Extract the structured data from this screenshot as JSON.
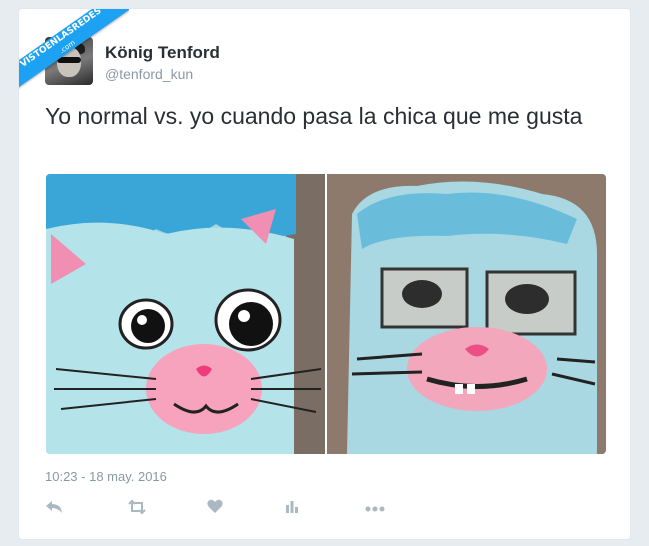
{
  "watermark": {
    "line1": "VISTOENLASREDES",
    "line2": ".com"
  },
  "tweet": {
    "author_name": "König Tenford",
    "author_handle": "@tenford_kun",
    "text": "Yo normal vs. yo cuando pasa la chica que me gusta",
    "timestamp": "10:23 - 18 may. 2016"
  },
  "colors": {
    "accent": "#1da1f2",
    "text": "#292f33",
    "muted": "#8899a6"
  },
  "icons": [
    "reply-icon",
    "retweet-icon",
    "like-icon",
    "analytics-icon",
    "more-icon"
  ]
}
